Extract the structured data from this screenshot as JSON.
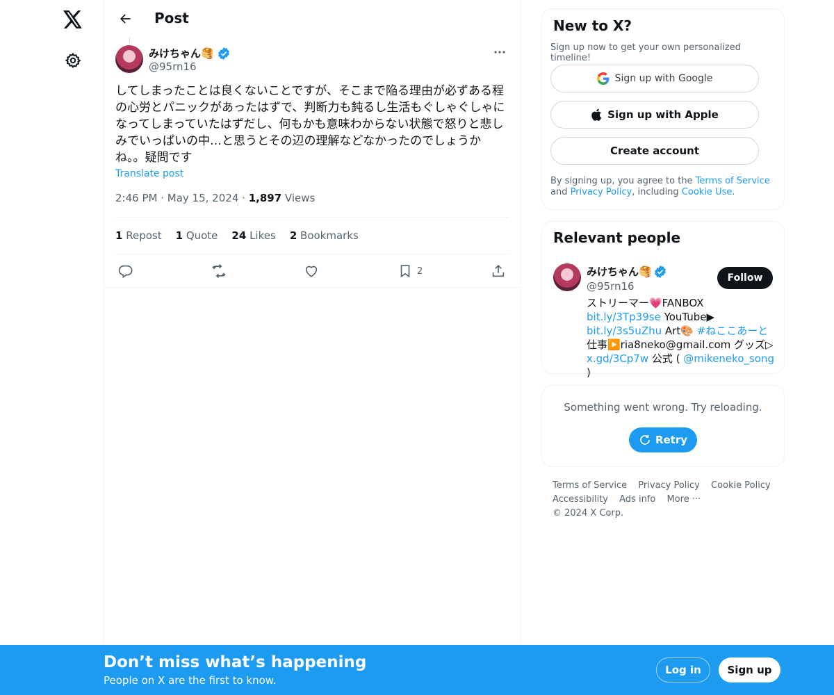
{
  "header": {
    "title": "Post"
  },
  "post": {
    "author_name": "みけちゃん🥞",
    "author_handle": "@95rn16",
    "text": "してしまったことは良くないことですが、そこまで陥る理由が必ずある程\nの心労とパニックがあったはずで、判断力も鈍るし生活もぐしゃぐしゃに\nなってしまっていたはずだし、何もかも意味わからない状態で怒りと悲し\nみでいっぱいの中…と思うとその辺の理解などなかったのでしょうか\nね。。疑問です",
    "translate_label": "Translate post",
    "time": "2:46 PM",
    "date": "May 15, 2024",
    "views_count": "1,897",
    "views_label": "Views",
    "stats": {
      "reposts_count": "1",
      "reposts_label": "Repost",
      "quotes_count": "1",
      "quotes_label": "Quote",
      "likes_count": "24",
      "likes_label": "Likes",
      "bookmarks_count": "2",
      "bookmarks_label": "Bookmarks"
    },
    "bookmark_action_count": "2"
  },
  "signup_card": {
    "title": "New to X?",
    "subtitle": "Sign up now to get your own personalized timeline!",
    "google_label": "Sign up with Google",
    "apple_label": "Sign up with Apple",
    "create_label": "Create account",
    "terms_prefix": "By signing up, you agree to the ",
    "terms_link": "Terms of Service",
    "terms_and": " and ",
    "privacy_link": "Privacy Policy",
    "terms_including": ", including ",
    "cookie_link": "Cookie Use",
    "terms_end": "."
  },
  "relevant_people": {
    "title": "Relevant people",
    "name": "みけちゃん🥞",
    "handle": "@95rn16",
    "follow_label": "Follow",
    "bio": {
      "line1": "ストリーマー💗FANBOX",
      "link1": "bit.ly/3Tp39se",
      "youtube": " YouTube▶",
      "link2": "bit.ly/3s5uZhu",
      "art": " Art🎨",
      "hashtag": "#ねここあーと",
      "work": " 仕事▶️ria8neko@gmail.com グッズ▷",
      "link3": "x.gd/3Cp7w",
      "official": " 公式 ( ",
      "mention": "@mikeneko_song",
      "close": " )"
    }
  },
  "error_card": {
    "message": "Something went wrong. Try reloading.",
    "retry_label": "Retry"
  },
  "footer": {
    "terms": "Terms of Service",
    "privacy": "Privacy Policy",
    "cookie": "Cookie Policy",
    "accessibility": "Accessibility",
    "ads": "Ads info",
    "more": "More ···",
    "copyright": "© 2024 X Corp."
  },
  "banner": {
    "title": "Don’t miss what’s happening",
    "subtitle": "People on X are the first to know.",
    "login_label": "Log in",
    "signup_label": "Sign up"
  },
  "colors": {
    "accent": "#1d9bf0",
    "text": "#0f1419",
    "secondary": "#536471",
    "border": "#eff3f4"
  }
}
